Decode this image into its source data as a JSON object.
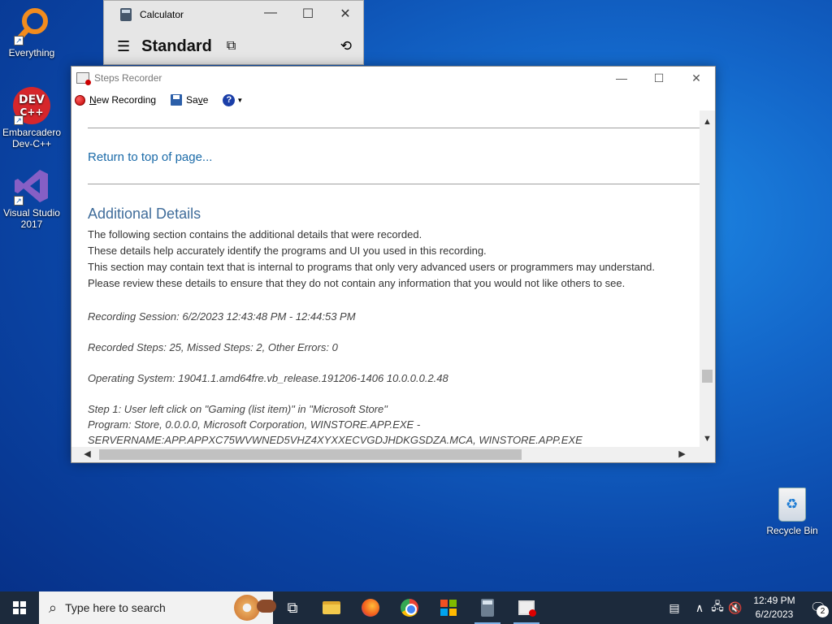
{
  "desktop": {
    "icons": [
      {
        "label": "Everything"
      },
      {
        "label": "Embarcadero Dev-C++"
      },
      {
        "label": "Visual Studio 2017"
      }
    ],
    "recycle_bin": "Recycle Bin",
    "devcpp_logo_text": "DEV C++"
  },
  "calculator": {
    "title": "Calculator",
    "mode": "Standard",
    "controls": {
      "minimize": "—",
      "maximize": "☐",
      "close": "✕"
    }
  },
  "steps_recorder": {
    "title": "Steps Recorder",
    "controls": {
      "minimize": "—",
      "maximize": "☐",
      "close": "✕"
    },
    "toolbar": {
      "new_recording_prefix": "N",
      "new_recording_rest": "ew Recording",
      "save_prefix": "Sa",
      "save_u": "v",
      "save_rest": "e",
      "help": "?"
    },
    "content": {
      "return_link": "Return to top of page...",
      "heading": "Additional Details",
      "paragraph": [
        "The following section contains the additional details that were recorded.",
        "These details help accurately identify the programs and UI you used in this recording.",
        "This section may contain text that is internal to programs that only very advanced users or programmers may understand.",
        "Please review these details to ensure that they do not contain any information that you would not like others to see."
      ],
      "session": "Recording Session: 6/2/2023 12:43:48 PM - 12:44:53 PM",
      "steps": "Recorded Steps: 25, Missed Steps: 2, Other Errors: 0",
      "os": "Operating System: 19041.1.amd64fre.vb_release.191206-1406 10.0.0.0.2.48",
      "step1_line1": "Step 1: User left click on \"Gaming (list item)\" in \"Microsoft Store\"",
      "step1_line2": "Program: Store, 0.0.0.0, Microsoft Corporation, WINSTORE.APP.EXE -",
      "step1_line3": "SERVERNAME:APP.APPXC75WVWNED5VHZ4XYXXECVGDJHDKGSDZA.MCA, WINSTORE.APP.EXE"
    }
  },
  "taskbar": {
    "search_placeholder": "Type here to search",
    "clock_time": "12:49 PM",
    "clock_date": "6/2/2023",
    "notification_count": "2"
  }
}
